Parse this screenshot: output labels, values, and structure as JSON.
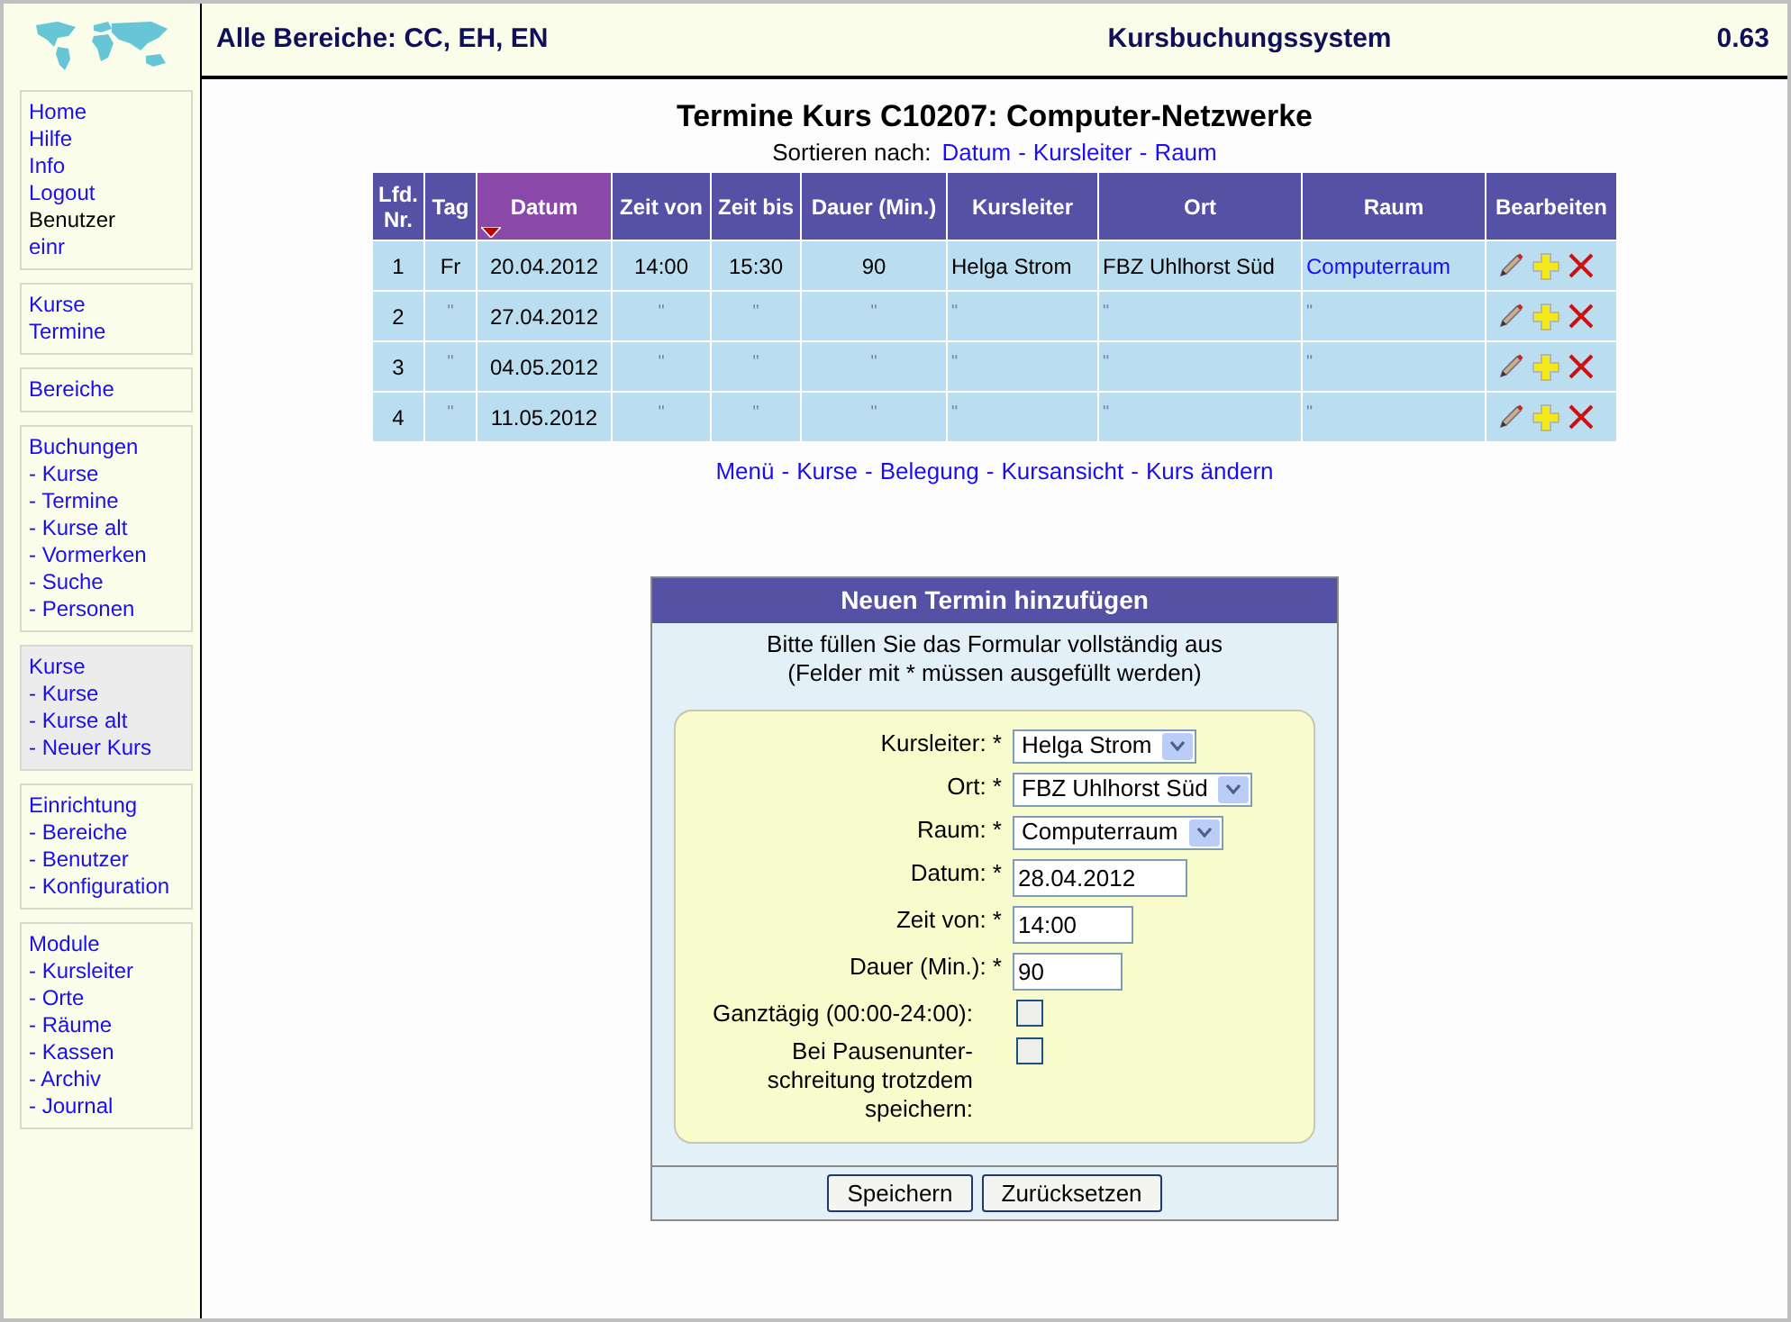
{
  "header": {
    "areas": "Alle Bereiche: CC, EH, EN",
    "title": "Kursbuchungssystem",
    "version": "0.63"
  },
  "sidebar": {
    "groups": [
      {
        "active": false,
        "items": [
          {
            "label": "Home",
            "link": true
          },
          {
            "label": "Hilfe",
            "link": true
          },
          {
            "label": "Info",
            "link": true
          },
          {
            "label": "Logout",
            "link": true
          },
          {
            "label": "Benutzer",
            "link": false
          },
          {
            "label": "einr",
            "link": true
          }
        ]
      },
      {
        "active": false,
        "items": [
          {
            "label": "Kurse",
            "link": true
          },
          {
            "label": "Termine",
            "link": true
          }
        ]
      },
      {
        "active": false,
        "items": [
          {
            "label": "Bereiche",
            "link": true
          }
        ]
      },
      {
        "active": false,
        "items": [
          {
            "label": "Buchungen",
            "link": true
          },
          {
            "label": "- Kurse",
            "link": true
          },
          {
            "label": "- Termine",
            "link": true
          },
          {
            "label": "- Kurse alt",
            "link": true
          },
          {
            "label": "- Vormerken",
            "link": true
          },
          {
            "label": "- Suche",
            "link": true
          },
          {
            "label": "- Personen",
            "link": true
          }
        ]
      },
      {
        "active": true,
        "items": [
          {
            "label": "Kurse",
            "link": true
          },
          {
            "label": "- Kurse",
            "link": true
          },
          {
            "label": "- Kurse alt",
            "link": true
          },
          {
            "label": "- Neuer Kurs",
            "link": true
          }
        ]
      },
      {
        "active": false,
        "items": [
          {
            "label": "Einrichtung",
            "link": true
          },
          {
            "label": "- Bereiche",
            "link": true
          },
          {
            "label": "- Benutzer",
            "link": true
          },
          {
            "label": "- Konfiguration",
            "link": true
          }
        ]
      },
      {
        "active": false,
        "items": [
          {
            "label": "Module",
            "link": true
          },
          {
            "label": "- Kursleiter",
            "link": true
          },
          {
            "label": "- Orte",
            "link": true
          },
          {
            "label": "- Räume",
            "link": true
          },
          {
            "label": "- Kassen",
            "link": true
          },
          {
            "label": "- Archiv",
            "link": true
          },
          {
            "label": "- Journal",
            "link": true
          }
        ]
      }
    ]
  },
  "page_title": "Termine Kurs C10207: Computer-Netzwerke",
  "sort": {
    "label": "Sortieren nach:",
    "links": [
      "Datum",
      "Kursleiter",
      "Raum"
    ],
    "separator": "-"
  },
  "table": {
    "columns": [
      {
        "label": "Lfd. Nr.",
        "selected": false
      },
      {
        "label": "Tag",
        "selected": false
      },
      {
        "label": "Datum",
        "selected": true
      },
      {
        "label": "Zeit von",
        "selected": false
      },
      {
        "label": "Zeit bis",
        "selected": false
      },
      {
        "label": "Dauer (Min.)",
        "selected": false
      },
      {
        "label": "Kursleiter",
        "selected": false
      },
      {
        "label": "Ort",
        "selected": false
      },
      {
        "label": "Raum",
        "selected": false
      },
      {
        "label": "Bearbeiten",
        "selected": false
      }
    ],
    "rows": [
      [
        "1",
        "Fr",
        "20.04.2012",
        "14:00",
        "15:30",
        "90",
        "Helga Strom",
        "FBZ Uhlhorst Süd",
        "Computerraum"
      ],
      [
        "2",
        "\"",
        "27.04.2012",
        "\"",
        "\"",
        "\"",
        "\"",
        "\"",
        "\""
      ],
      [
        "3",
        "\"",
        "04.05.2012",
        "\"",
        "\"",
        "\"",
        "\"",
        "\"",
        "\""
      ],
      [
        "4",
        "\"",
        "11.05.2012",
        "\"",
        "\"",
        "\"",
        "\"",
        "\"",
        "\""
      ]
    ]
  },
  "bottom_links": [
    "Menü",
    "Kurse",
    "Belegung",
    "Kursansicht",
    "Kurs ändern"
  ],
  "form": {
    "title": "Neuen Termin hinzufügen",
    "intro": [
      "Bitte füllen Sie das Formular vollständig aus",
      "(Felder mit * müssen ausgefüllt werden)"
    ],
    "fields": [
      {
        "kind": "select",
        "label": "Kursleiter: *",
        "value": "Helga Strom"
      },
      {
        "kind": "select",
        "label": "Ort: *",
        "value": "FBZ Uhlhorst Süd"
      },
      {
        "kind": "select",
        "label": "Raum: *",
        "value": "Computerraum"
      },
      {
        "kind": "text",
        "label": "Datum: *",
        "value": "28.04.2012"
      },
      {
        "kind": "text",
        "label": "Zeit von: *",
        "value": "14:00"
      },
      {
        "kind": "text",
        "label": "Dauer (Min.): *",
        "value": "90"
      },
      {
        "kind": "checkbox",
        "label": "Ganztägig (00:00-24:00):",
        "checked": false
      },
      {
        "kind": "checkbox",
        "label": "Bei Pausenunter-schreitung trotzdem speichern:",
        "checked": false
      }
    ],
    "buttons": [
      "Speichern",
      "Zurücksetzen"
    ]
  }
}
